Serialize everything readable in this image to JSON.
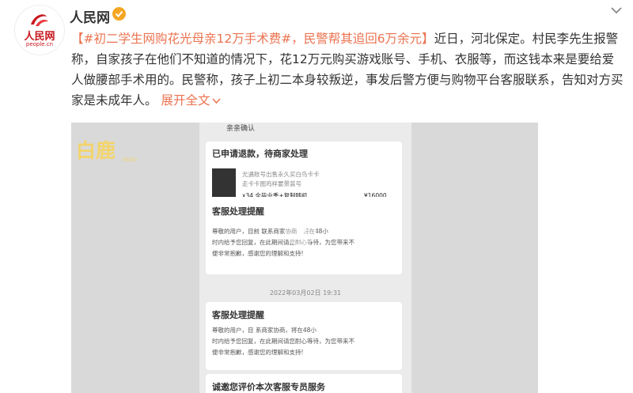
{
  "header": {
    "username": "人民网",
    "avatar_text": "人民网",
    "avatar_sub": "people.cn"
  },
  "post": {
    "tag": "【#初二学生网购花光母亲12万手术费#，民警帮其追回6万余元】",
    "body": "近日，河北保定。村民李先生报警称，自家孩子在他们不知道的情况下，花12万元购买游戏账号、手机、衣服等，而这钱本来是要给爱人做腰部手术用的。民警称，孩子上初二本身较叛逆，事发后警方便与购物平台客服联系，告知对方买家是未成年人。",
    "expand": "展开全文",
    "expand_icon": "chevron-down-icon"
  },
  "video": {
    "watermark": "白鹿",
    "watermark_sub": "VIDEO",
    "top_label": "亲亲确认",
    "refund_status": "已申请退款，待商家处理",
    "product_line1": "光遇账号出售永久买白鸟卡卡",
    "product_line2": "走卡卡图鸡样要景装号",
    "product_qty": "x34,全毕业季+复制随机",
    "product_price": "¥16000",
    "cs_title": "客服处理提醒",
    "cs_msg1": "尊敬的用户，目前",
    "cs_msg1b": "联系商家协商，将在48小",
    "cs_msg2": "时内给予您回复，在此期间请您耐心等待，为您带来不",
    "cs_msg3": "便非常抱歉，感谢您的理解和支持!",
    "timestamp": "2022年03月02日 19:31",
    "cs_title2": "客服处理提醒",
    "cs2_msg1": "尊敬的用户，目",
    "cs2_msg1b": "系商家协商，将在48小",
    "cs2_msg2": "时内给予您回复，在此期间请您耐心等待，为您带来不",
    "cs2_msg3": "便非常抱歉，感谢您的理解和支持!",
    "bottom_label": "诚邀您评价本次客服专员服务"
  }
}
